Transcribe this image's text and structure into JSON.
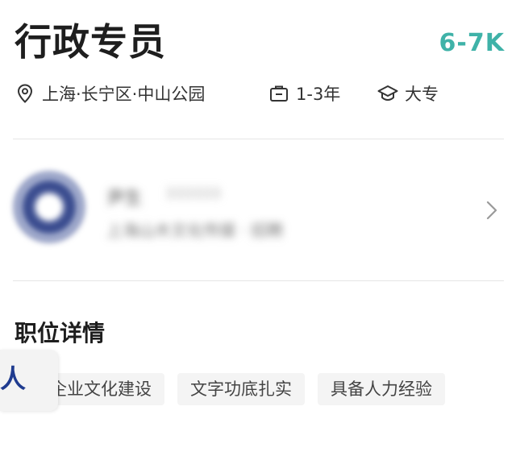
{
  "job": {
    "title": "行政专员",
    "salary": "6-7K",
    "location": "上海·长宁区·中山公园",
    "experience": "1-3年",
    "education": "大专"
  },
  "company": {
    "name_blurred": "尹生",
    "extra_blurred": "333333",
    "desc_blurred": "上海山木文化传媒 · 招聘"
  },
  "details": {
    "section_title": "职位详情",
    "tags": [
      "企业文化建设",
      "文字功底扎实",
      "具备人力经验"
    ]
  },
  "float_widget": {
    "char": "人"
  },
  "colors": {
    "salary": "#3fb2a8",
    "float_char": "#1f3b8f"
  },
  "icons": {
    "location": "location-pin-icon",
    "experience": "briefcase-icon",
    "education": "graduation-cap-icon",
    "chevron": "chevron-right-icon"
  }
}
